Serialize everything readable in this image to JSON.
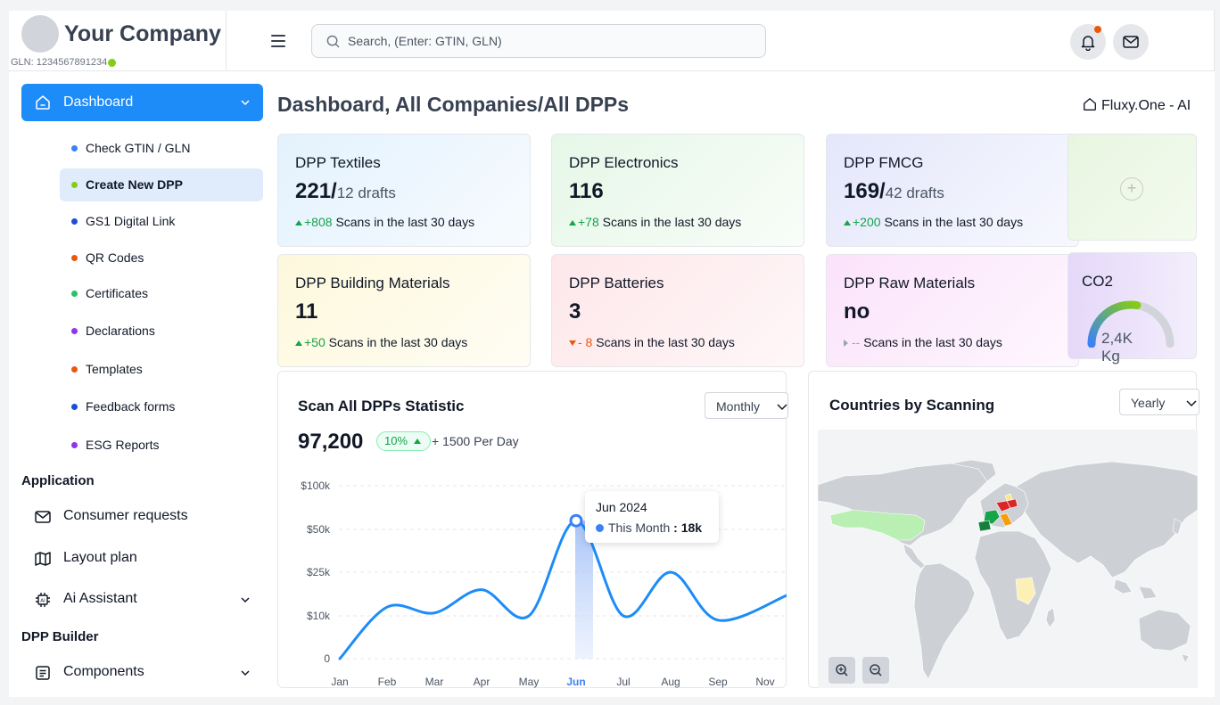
{
  "brand": {
    "name": "Your Company",
    "gln": "GLN: 1234567891234"
  },
  "search": {
    "placeholder": "Search, (Enter: GTIN, GLN)"
  },
  "sidebar": {
    "dashboard": "Dashboard",
    "subitems": [
      {
        "label": "Check GTIN / GLN",
        "color": "#3b82f6"
      },
      {
        "label": "Create New DPP",
        "color": "#84cc16"
      },
      {
        "label": "GS1 Digital Link",
        "color": "#1d4ed8"
      },
      {
        "label": "QR Codes",
        "color": "#ea580c"
      },
      {
        "label": "Certificates",
        "color": "#22c55e"
      },
      {
        "label": "Declarations",
        "color": "#9333ea"
      },
      {
        "label": "Templates",
        "color": "#ea580c"
      },
      {
        "label": "Feedback forms",
        "color": "#1d4ed8"
      },
      {
        "label": "ESG Reports",
        "color": "#9333ea"
      }
    ],
    "application_title": "Application",
    "consumer_requests": "Consumer requests",
    "layout_plan": "Layout plan",
    "ai_assistant": "Ai Assistant",
    "dpp_builder_title": "DPP Builder",
    "components": "Components"
  },
  "main": {
    "title": "Dashboard, All Companies/All DPPs",
    "fluxy": "Fluxy.One - AI"
  },
  "cards": [
    {
      "title": "DPP Textiles",
      "value": "221/",
      "drafts": "12 drafts",
      "delta": "+808",
      "trend": "up",
      "suffix": "Scans in the last 30 days"
    },
    {
      "title": "DPP Electronics",
      "value": "116",
      "drafts": "",
      "delta": "+78",
      "trend": "up",
      "suffix": "Scans in the last 30 days"
    },
    {
      "title": "DPP FMCG",
      "value": "169/",
      "drafts": "42 drafts",
      "delta": "+200",
      "trend": "up",
      "suffix": "Scans in the last 30 days"
    },
    {
      "title": "DPP Building Materials",
      "value": "11",
      "drafts": "",
      "delta": "+50",
      "trend": "up",
      "suffix": "Scans in the last 30 days"
    },
    {
      "title": "DPP Batteries",
      "value": "3",
      "drafts": "",
      "delta": "- 8",
      "trend": "down",
      "suffix": "Scans in the last 30 days"
    },
    {
      "title": "DPP Raw Materials",
      "value": "no",
      "drafts": "",
      "delta": "--",
      "trend": "flat",
      "suffix": "Scans in the last 30 days"
    }
  ],
  "add_card": {
    "plus": "+"
  },
  "co2": {
    "title": "CO2",
    "value": "2,4K",
    "unit": "Kg",
    "gauge_fraction": 0.55
  },
  "scan_chart": {
    "title": "Scan All DPPs Statistic",
    "total": "97,200",
    "change_pct": "10%",
    "per_day": "+ 1500 Per Day",
    "period": "Monthly",
    "tooltip": {
      "header": "Jun 2024",
      "series": "This Month",
      "value": ": 18k"
    }
  },
  "chart_data": {
    "type": "line",
    "categories": [
      "Jan",
      "Feb",
      "Mar",
      "Apr",
      "May",
      "Jun",
      "Jul",
      "Aug",
      "Sep",
      "Nov"
    ],
    "y_ticks": [
      "$100k",
      "$50k",
      "$25k",
      "$10k",
      "0"
    ],
    "y_tick_values": [
      100,
      50,
      25,
      10,
      0
    ],
    "series": [
      {
        "name": "This Month",
        "values": [
          0,
          13,
          11,
          19,
          10,
          60,
          10,
          25,
          9,
          17
        ]
      }
    ],
    "highlight": "Jun",
    "color": "#1d8cf8",
    "grid": true
  },
  "map": {
    "title": "Countries by Scanning",
    "period": "Yearly"
  }
}
